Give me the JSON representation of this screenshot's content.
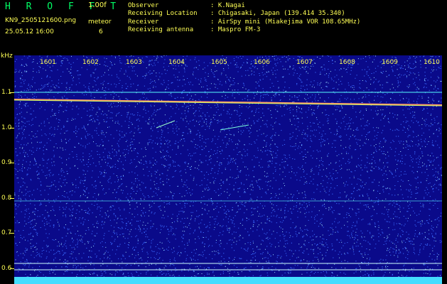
{
  "header": {
    "app_title": "H R O F F T",
    "version": "1.00f",
    "filename": "KN9_2505121600.png",
    "meteor_label": "meteor",
    "datetime": "25.05.12 16:00",
    "meteor_count": "6",
    "fields": [
      {
        "label": "Observer",
        "value": ": K.Nagai"
      },
      {
        "label": "Receiving Location",
        "value": ": Chigasaki, Japan (139.414 35.340)"
      },
      {
        "label": "Receiver",
        "value": ": AirSpy mini (Miakejima VOR 108.65MHz)"
      },
      {
        "label": "Receiving antenna",
        "value": ": Maspro FM-3"
      }
    ]
  },
  "axis": {
    "y_unit": "kHz",
    "y_labels": [
      "1.1",
      "1.0",
      "0.9",
      "0.8",
      "0.7",
      "0.6"
    ],
    "x_labels": [
      "1601",
      "1602",
      "1603",
      "1604",
      "1605",
      "1606",
      "1607",
      "1608",
      "1609",
      "1610"
    ]
  },
  "colors": {
    "background": "#000000",
    "spectrum": "#0a0a8a",
    "text": "#ffff55",
    "title": "#00ff66",
    "line": "#55ffff"
  }
}
